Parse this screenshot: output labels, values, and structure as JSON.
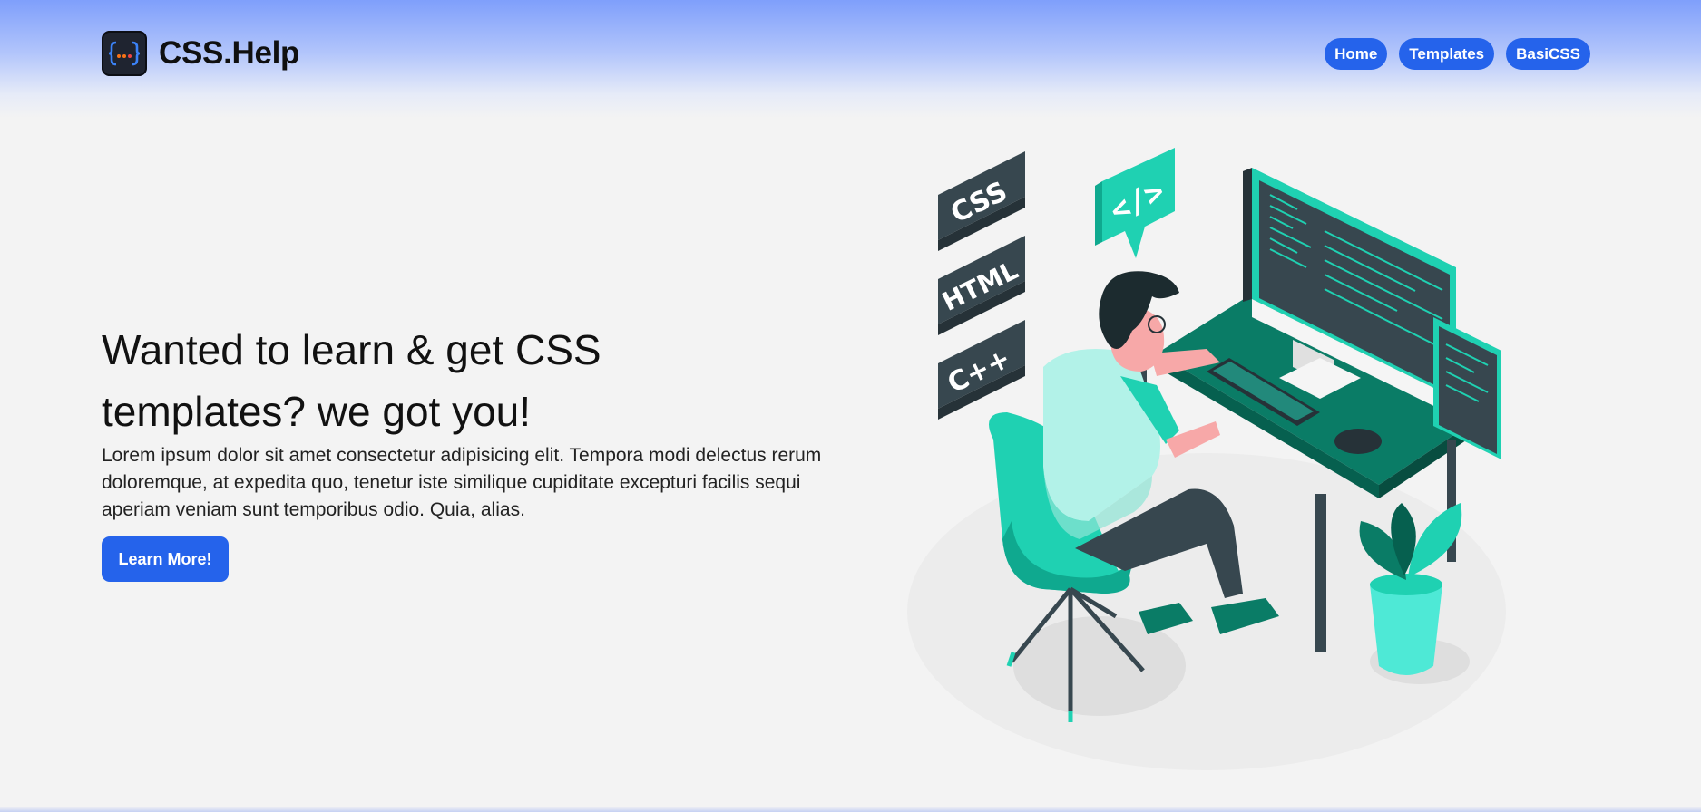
{
  "brand": {
    "name": "CSS.Help",
    "logo_icon": "curly-braces-dots-logo"
  },
  "nav": {
    "items": [
      "Home",
      "Templates",
      "BasiCSS"
    ]
  },
  "hero": {
    "title": "Wanted to learn & get CSS templates? we got you!",
    "description": "Lorem ipsum dolor sit amet consectetur adipisicing elit. Tempora modi delectus rerum doloremque, at expedita quo, tenetur iste similique cupiditate excepturi facilis sequi aperiam veniam sunt temporibus odio. Quia, alias.",
    "cta_label": "Learn More!"
  },
  "illustration": {
    "tiles": [
      "CSS",
      "HTML",
      "C++"
    ],
    "code_bubble": "</>"
  },
  "colors": {
    "accent": "#2563eb",
    "teal": "#00c9a7",
    "dark_teal": "#0a7c66",
    "slate": "#37474f"
  }
}
